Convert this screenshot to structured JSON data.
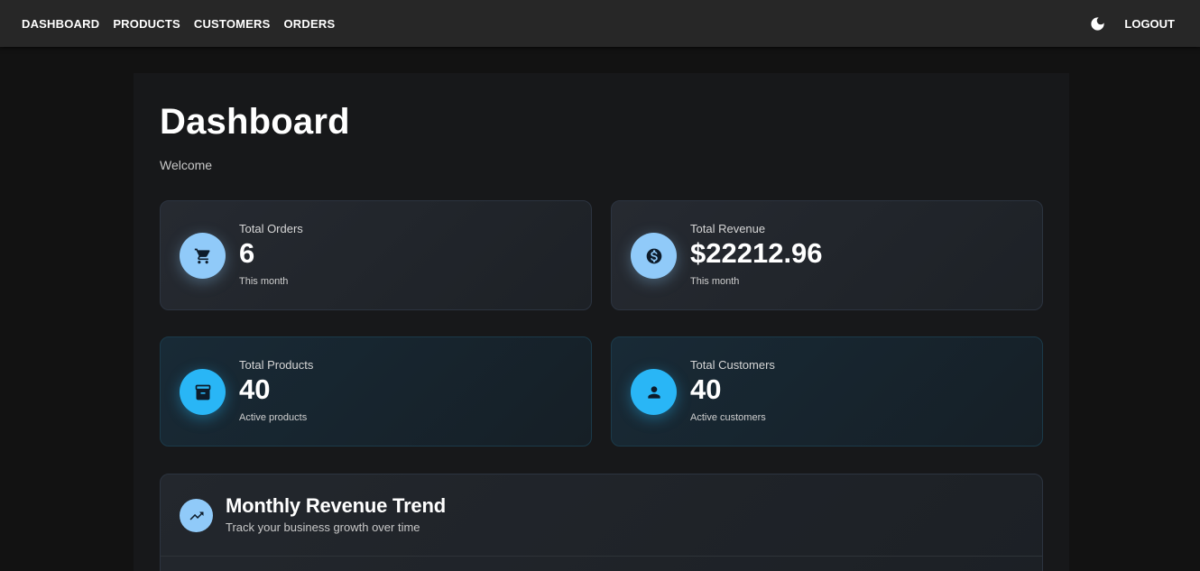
{
  "nav": {
    "items": [
      {
        "label": "DASHBOARD"
      },
      {
        "label": "PRODUCTS"
      },
      {
        "label": "CUSTOMERS"
      },
      {
        "label": "ORDERS"
      }
    ],
    "theme_icon": "moon-icon",
    "logout_label": "LOGOUT"
  },
  "page": {
    "title": "Dashboard",
    "subtitle": "Welcome"
  },
  "stats": [
    {
      "label": "Total Orders",
      "value": "6",
      "caption": "This month",
      "icon": "cart-icon",
      "accent": "#90caf9"
    },
    {
      "label": "Total Revenue",
      "value": "$22212.96",
      "caption": "This month",
      "icon": "dollar-icon",
      "accent": "#90caf9"
    },
    {
      "label": "Total Products",
      "value": "40",
      "caption": "Active products",
      "icon": "archive-icon",
      "accent": "#29b6f6"
    },
    {
      "label": "Total Customers",
      "value": "40",
      "caption": "Active customers",
      "icon": "person-icon",
      "accent": "#29b6f6"
    }
  ],
  "trend": {
    "title": "Monthly Revenue Trend",
    "subtitle": "Track your business growth over time",
    "icon": "trending-up-icon"
  },
  "colors": {
    "background": "#121212",
    "appbar": "#272727",
    "primary_light": "#90caf9",
    "info": "#29b6f6"
  }
}
